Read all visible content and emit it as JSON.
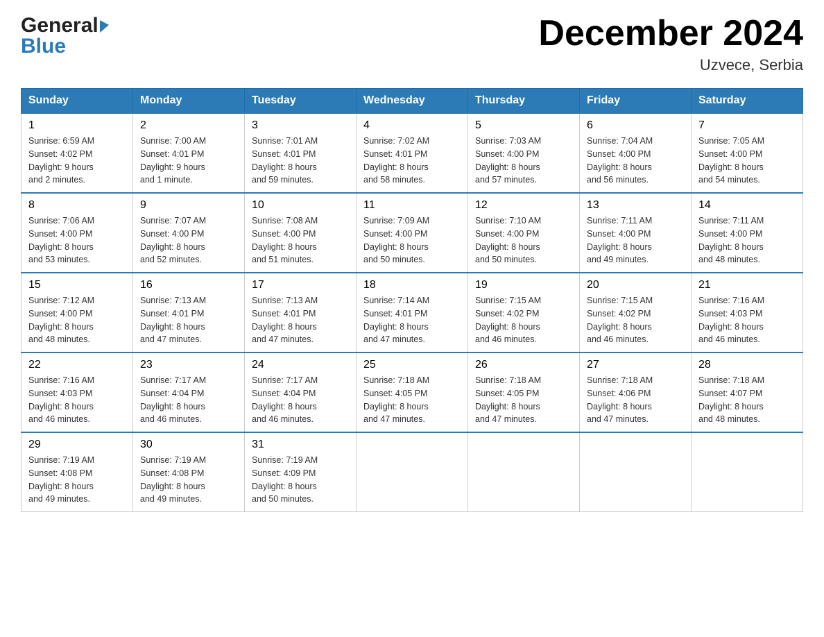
{
  "header": {
    "logo_line1": "General",
    "logo_line2": "Blue",
    "month_title": "December 2024",
    "location": "Uzvece, Serbia"
  },
  "days_of_week": [
    "Sunday",
    "Monday",
    "Tuesday",
    "Wednesday",
    "Thursday",
    "Friday",
    "Saturday"
  ],
  "weeks": [
    [
      {
        "day": "1",
        "sunrise": "6:59 AM",
        "sunset": "4:02 PM",
        "daylight": "9 hours and 2 minutes."
      },
      {
        "day": "2",
        "sunrise": "7:00 AM",
        "sunset": "4:01 PM",
        "daylight": "9 hours and 1 minute."
      },
      {
        "day": "3",
        "sunrise": "7:01 AM",
        "sunset": "4:01 PM",
        "daylight": "8 hours and 59 minutes."
      },
      {
        "day": "4",
        "sunrise": "7:02 AM",
        "sunset": "4:01 PM",
        "daylight": "8 hours and 58 minutes."
      },
      {
        "day": "5",
        "sunrise": "7:03 AM",
        "sunset": "4:00 PM",
        "daylight": "8 hours and 57 minutes."
      },
      {
        "day": "6",
        "sunrise": "7:04 AM",
        "sunset": "4:00 PM",
        "daylight": "8 hours and 56 minutes."
      },
      {
        "day": "7",
        "sunrise": "7:05 AM",
        "sunset": "4:00 PM",
        "daylight": "8 hours and 54 minutes."
      }
    ],
    [
      {
        "day": "8",
        "sunrise": "7:06 AM",
        "sunset": "4:00 PM",
        "daylight": "8 hours and 53 minutes."
      },
      {
        "day": "9",
        "sunrise": "7:07 AM",
        "sunset": "4:00 PM",
        "daylight": "8 hours and 52 minutes."
      },
      {
        "day": "10",
        "sunrise": "7:08 AM",
        "sunset": "4:00 PM",
        "daylight": "8 hours and 51 minutes."
      },
      {
        "day": "11",
        "sunrise": "7:09 AM",
        "sunset": "4:00 PM",
        "daylight": "8 hours and 50 minutes."
      },
      {
        "day": "12",
        "sunrise": "7:10 AM",
        "sunset": "4:00 PM",
        "daylight": "8 hours and 50 minutes."
      },
      {
        "day": "13",
        "sunrise": "7:11 AM",
        "sunset": "4:00 PM",
        "daylight": "8 hours and 49 minutes."
      },
      {
        "day": "14",
        "sunrise": "7:11 AM",
        "sunset": "4:00 PM",
        "daylight": "8 hours and 48 minutes."
      }
    ],
    [
      {
        "day": "15",
        "sunrise": "7:12 AM",
        "sunset": "4:00 PM",
        "daylight": "8 hours and 48 minutes."
      },
      {
        "day": "16",
        "sunrise": "7:13 AM",
        "sunset": "4:01 PM",
        "daylight": "8 hours and 47 minutes."
      },
      {
        "day": "17",
        "sunrise": "7:13 AM",
        "sunset": "4:01 PM",
        "daylight": "8 hours and 47 minutes."
      },
      {
        "day": "18",
        "sunrise": "7:14 AM",
        "sunset": "4:01 PM",
        "daylight": "8 hours and 47 minutes."
      },
      {
        "day": "19",
        "sunrise": "7:15 AM",
        "sunset": "4:02 PM",
        "daylight": "8 hours and 46 minutes."
      },
      {
        "day": "20",
        "sunrise": "7:15 AM",
        "sunset": "4:02 PM",
        "daylight": "8 hours and 46 minutes."
      },
      {
        "day": "21",
        "sunrise": "7:16 AM",
        "sunset": "4:03 PM",
        "daylight": "8 hours and 46 minutes."
      }
    ],
    [
      {
        "day": "22",
        "sunrise": "7:16 AM",
        "sunset": "4:03 PM",
        "daylight": "8 hours and 46 minutes."
      },
      {
        "day": "23",
        "sunrise": "7:17 AM",
        "sunset": "4:04 PM",
        "daylight": "8 hours and 46 minutes."
      },
      {
        "day": "24",
        "sunrise": "7:17 AM",
        "sunset": "4:04 PM",
        "daylight": "8 hours and 46 minutes."
      },
      {
        "day": "25",
        "sunrise": "7:18 AM",
        "sunset": "4:05 PM",
        "daylight": "8 hours and 47 minutes."
      },
      {
        "day": "26",
        "sunrise": "7:18 AM",
        "sunset": "4:05 PM",
        "daylight": "8 hours and 47 minutes."
      },
      {
        "day": "27",
        "sunrise": "7:18 AM",
        "sunset": "4:06 PM",
        "daylight": "8 hours and 47 minutes."
      },
      {
        "day": "28",
        "sunrise": "7:18 AM",
        "sunset": "4:07 PM",
        "daylight": "8 hours and 48 minutes."
      }
    ],
    [
      {
        "day": "29",
        "sunrise": "7:19 AM",
        "sunset": "4:08 PM",
        "daylight": "8 hours and 49 minutes."
      },
      {
        "day": "30",
        "sunrise": "7:19 AM",
        "sunset": "4:08 PM",
        "daylight": "8 hours and 49 minutes."
      },
      {
        "day": "31",
        "sunrise": "7:19 AM",
        "sunset": "4:09 PM",
        "daylight": "8 hours and 50 minutes."
      },
      null,
      null,
      null,
      null
    ]
  ],
  "sunrise_label": "Sunrise:",
  "sunset_label": "Sunset:",
  "daylight_label": "Daylight:"
}
